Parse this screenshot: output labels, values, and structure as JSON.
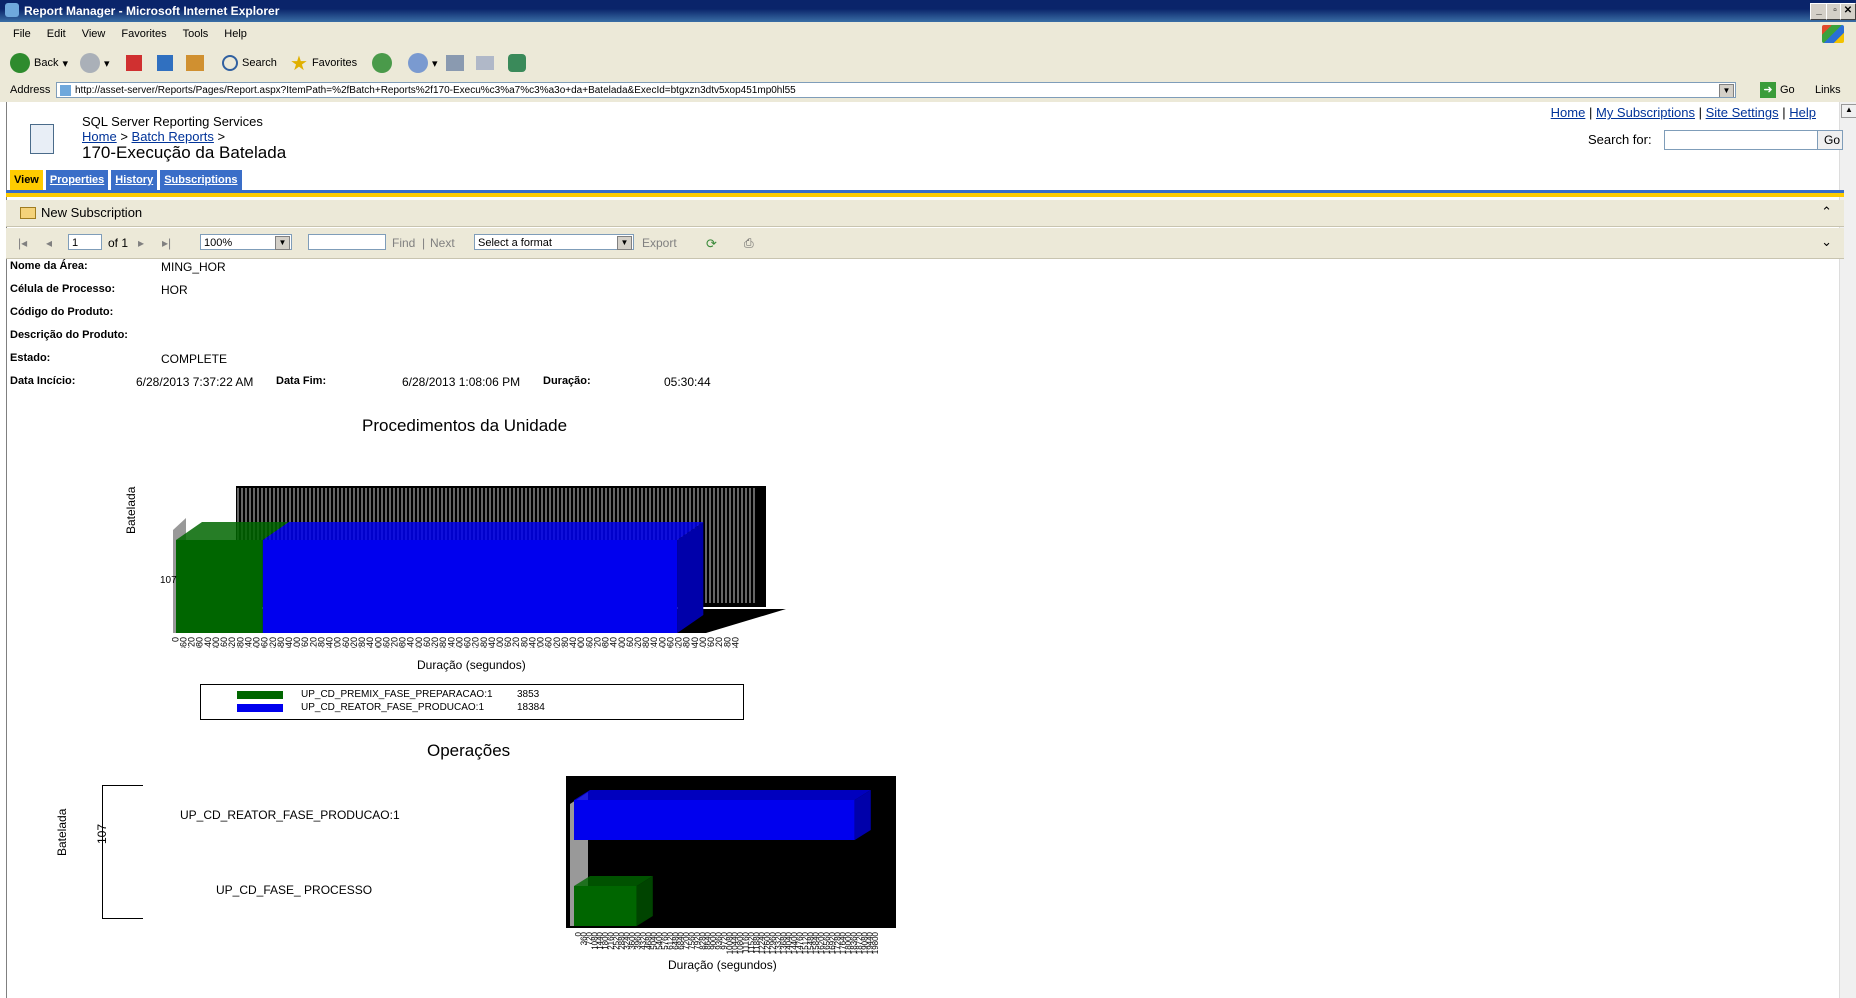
{
  "window": {
    "title": "Report Manager - Microsoft Internet Explorer"
  },
  "menu": [
    "File",
    "Edit",
    "View",
    "Favorites",
    "Tools",
    "Help"
  ],
  "toolbar": {
    "back": "Back",
    "search": "Search",
    "favorites": "Favorites"
  },
  "address": {
    "label": "Address",
    "url": "http://asset-server/Reports/Pages/Report.aspx?ItemPath=%2fBatch+Reports%2f170-Execu%c3%a7%c3%a3o+da+Batelada&ExecId=btgxzn3dtv5xop451mp0hl55",
    "go": "Go",
    "links": "Links"
  },
  "header": {
    "app": "SQL Server Reporting Services",
    "crumb_home": "Home",
    "crumb_sep1": ">",
    "crumb_batch": "Batch Reports",
    "crumb_sep2": ">",
    "title": "170-Execução da Batelada",
    "links": {
      "home": "Home",
      "subs": "My Subscriptions",
      "settings": "Site Settings",
      "help": "Help",
      "sep": "|"
    },
    "search_label": "Search for:",
    "search_go": "Go"
  },
  "tabs": [
    "View",
    "Properties",
    "History",
    "Subscriptions"
  ],
  "subbar": {
    "new_subscription": "New Subscription"
  },
  "viewer": {
    "page": "1",
    "of": "of 1",
    "zoom": "100%",
    "find": "Find",
    "sep": "|",
    "next": "Next",
    "format": "Select a format",
    "export": "Export"
  },
  "fields": {
    "area_label": "Nome da Área:",
    "area_value": "MING_HOR",
    "cell_label": "Célula de Processo:",
    "cell_value": "HOR",
    "prod_code_label": "Código do Produto:",
    "prod_desc_label": "Descrição do Produto:",
    "state_label": "Estado:",
    "state_value": "COMPLETE",
    "start_label": "Data Incício:",
    "start_value": "6/28/2013 7:37:22 AM",
    "end_label": "Data Fim:",
    "end_value": "6/28/2013 1:08:06 PM",
    "dur_label": "Duração:",
    "dur_value": "05:30:44"
  },
  "colors": {
    "green": "#006600",
    "blue": "#0000ee",
    "gray": "#999999",
    "black": "#000000"
  },
  "chart_data": [
    {
      "type": "bar",
      "title": "Procedimentos da Unidade",
      "xlabel": "Duração (segundos)",
      "ylabel": "Batelada",
      "categories": [
        "107"
      ],
      "series": [
        {
          "name": "UP_CD_PREMIX_FASE_PREPARACAO:1",
          "values": [
            3853
          ]
        },
        {
          "name": "UP_CD_REATOR_FASE_PRODUCAO:1",
          "values": [
            18384
          ]
        }
      ],
      "xticks": [
        0,
        360,
        720,
        1080,
        1440,
        1800,
        2160,
        2520,
        2880,
        3240,
        3600,
        3960,
        4320,
        4680,
        5040,
        5400,
        5760,
        6120,
        6480,
        6840,
        7200,
        7560,
        7920,
        8280,
        8640,
        9000,
        9360,
        9720,
        10080,
        10440,
        10800,
        11160,
        11520,
        11880,
        12240,
        12600,
        12960,
        13320,
        13680,
        14040,
        14400,
        14760,
        15120,
        15480,
        15840,
        16200,
        16560,
        16920,
        17280,
        17640,
        18000,
        18360,
        18720,
        19080,
        19440,
        19800,
        20160,
        20520,
        20880,
        21240,
        21600,
        21960,
        22320,
        22680,
        23040,
        23400,
        23760,
        24120,
        24480,
        24840
      ],
      "xlim": [
        0,
        24840
      ],
      "legend_values": [
        "3853",
        "18384"
      ],
      "legend": "bottom"
    },
    {
      "type": "bar",
      "title": "Operações",
      "xlabel": "Duração (segundos)",
      "ylabel": "Batelada",
      "group_label": "107",
      "categories": [
        "UP_CD_REATOR_FASE_PRODUCAO:1",
        "UP_CD_FASE_ PROCESSO"
      ],
      "values": [
        18384,
        3853
      ],
      "xticks": [
        0,
        360,
        720,
        1080,
        1440,
        1800,
        2160,
        2520,
        2880,
        3240,
        3600,
        3960,
        4320,
        4680,
        5040,
        5400,
        5760,
        6120,
        6480,
        6840,
        7200,
        7560,
        7920,
        8280,
        8640,
        9000,
        9360,
        9720,
        10080,
        10440,
        10800,
        11160,
        11520,
        11880,
        12240,
        12600,
        12960,
        13320,
        13680,
        14040,
        14400,
        14760,
        15120,
        15480,
        15840,
        16200,
        16560,
        16920,
        17280,
        17640,
        18000,
        18360,
        18720,
        19080,
        19440,
        19800
      ],
      "xlim": [
        0,
        19800
      ]
    }
  ]
}
